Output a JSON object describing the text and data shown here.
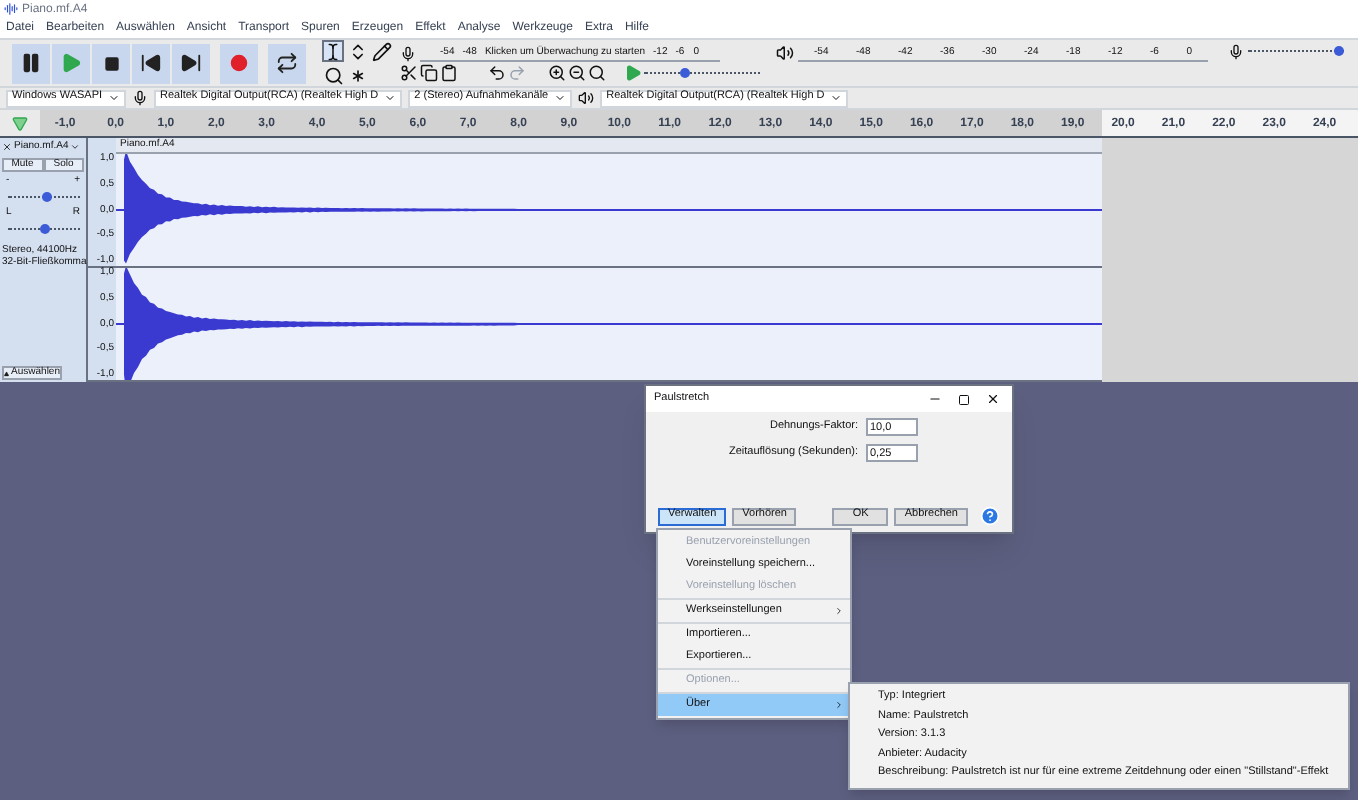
{
  "window": {
    "title": "Piano.mf.A4"
  },
  "menu_bar": [
    "Datei",
    "Bearbeiten",
    "Auswählen",
    "Ansicht",
    "Transport",
    "Spuren",
    "Erzeugen",
    "Effekt",
    "Analyse",
    "Werkzeuge",
    "Extra",
    "Hilfe"
  ],
  "transport": [
    {
      "kind": "pause"
    },
    {
      "kind": "play"
    },
    {
      "kind": "stop"
    },
    {
      "kind": "skip_start"
    },
    {
      "kind": "skip_end"
    },
    {
      "kind": "record"
    },
    {
      "kind": "loop"
    }
  ],
  "tools": [
    {
      "kind": "select",
      "selected": true
    },
    {
      "kind": "envelope",
      "selected": false
    },
    {
      "kind": "draw",
      "selected": false
    },
    {
      "kind": "zoom",
      "selected": false
    },
    {
      "kind": "multi",
      "selected": false
    }
  ],
  "record_meter": {
    "ticks_before": [
      "-54",
      "-48"
    ],
    "hint": "Klicken um Überwachung zu starten",
    "ticks_after": [
      "-12",
      "-6",
      "0"
    ]
  },
  "playback_meter": {
    "ticks": [
      "-54",
      "-48",
      "-42",
      "-36",
      "-30",
      "-24",
      "-18",
      "-12",
      "-6",
      "0"
    ]
  },
  "record_volume": {
    "level": 0.95
  },
  "play_at_speed": {
    "level": 0.35
  },
  "devices": {
    "host": "Windows WASAPI",
    "recording_device": "Realtek Digital Output(RCA) (Realtek High D",
    "channels": "2 (Stereo) Aufnahmekanäle",
    "playback_device": "Realtek Digital Output(RCA) (Realtek High D"
  },
  "ruler": {
    "ticks": [
      "-1,0",
      "0,0",
      "1,0",
      "2,0",
      "3,0",
      "4,0",
      "5,0",
      "6,0",
      "7,0",
      "8,0",
      "9,0",
      "10,0",
      "11,0",
      "12,0",
      "13,0",
      "14,0",
      "15,0",
      "16,0",
      "17,0",
      "18,0",
      "19,0",
      "20,0",
      "21,0",
      "22,0",
      "23,0",
      "24,0"
    ]
  },
  "track": {
    "name": "Piano.mf.A4",
    "buttons": [
      {
        "label": "Mute",
        "selected": false
      },
      {
        "label": "Solo",
        "selected": false
      }
    ],
    "gain_labels": [
      "-",
      "+"
    ],
    "gain": {
      "level": 0.55
    },
    "pan_labels": [
      "L",
      "R"
    ],
    "pan": {
      "level": 0.5
    },
    "info": [
      "Stereo, 44100Hz",
      "32-Bit-Fließkomma"
    ],
    "select_button": "Auswählen",
    "clip_name": "Piano.mf.A4",
    "channels": [
      {
        "scale": [
          "1,0",
          "0,5",
          "0,0",
          "-0,5",
          "-1,0"
        ]
      },
      {
        "scale": [
          "1,0",
          "0,5",
          "0,0",
          "-0,5",
          "-1,0"
        ]
      }
    ]
  },
  "dialog": {
    "title": "Paulstretch",
    "fields": [
      {
        "label": "Dehnungs-Faktor:",
        "value": "10,0"
      },
      {
        "label": "Zeitauflösung (Sekunden):",
        "value": "0,25"
      }
    ],
    "buttons": [
      {
        "label": "Verwalten",
        "selected": true
      },
      {
        "label": "Vorhören",
        "selected": false
      },
      {
        "label": "OK",
        "selected": false
      },
      {
        "label": "Abbrechen",
        "selected": false
      }
    ]
  },
  "menu": {
    "groups": [
      [
        {
          "label": "Benutzervoreinstellungen",
          "disabled": true,
          "submenu": false,
          "selected": false
        },
        {
          "label": "Voreinstellung speichern...",
          "disabled": false,
          "submenu": false,
          "selected": false
        },
        {
          "label": "Voreinstellung löschen",
          "disabled": true,
          "submenu": false,
          "selected": false
        }
      ],
      [
        {
          "label": "Werkseinstellungen",
          "disabled": false,
          "submenu": true,
          "selected": false
        }
      ],
      [
        {
          "label": "Importieren...",
          "disabled": false,
          "submenu": false,
          "selected": false
        },
        {
          "label": "Exportieren...",
          "disabled": false,
          "submenu": false,
          "selected": false
        }
      ],
      [
        {
          "label": "Optionen...",
          "disabled": true,
          "submenu": false,
          "selected": false
        }
      ],
      [
        {
          "label": "Über",
          "disabled": false,
          "submenu": true,
          "selected": true
        }
      ]
    ]
  },
  "about": [
    "Typ: Integriert",
    "Name: Paulstretch",
    "Version: 3.1.3",
    "Anbieter: Audacity",
    "Beschreibung: Paulstretch ist nur für eine extreme Zeitdehnung oder einen \"Stillstand\"-Effekt"
  ]
}
